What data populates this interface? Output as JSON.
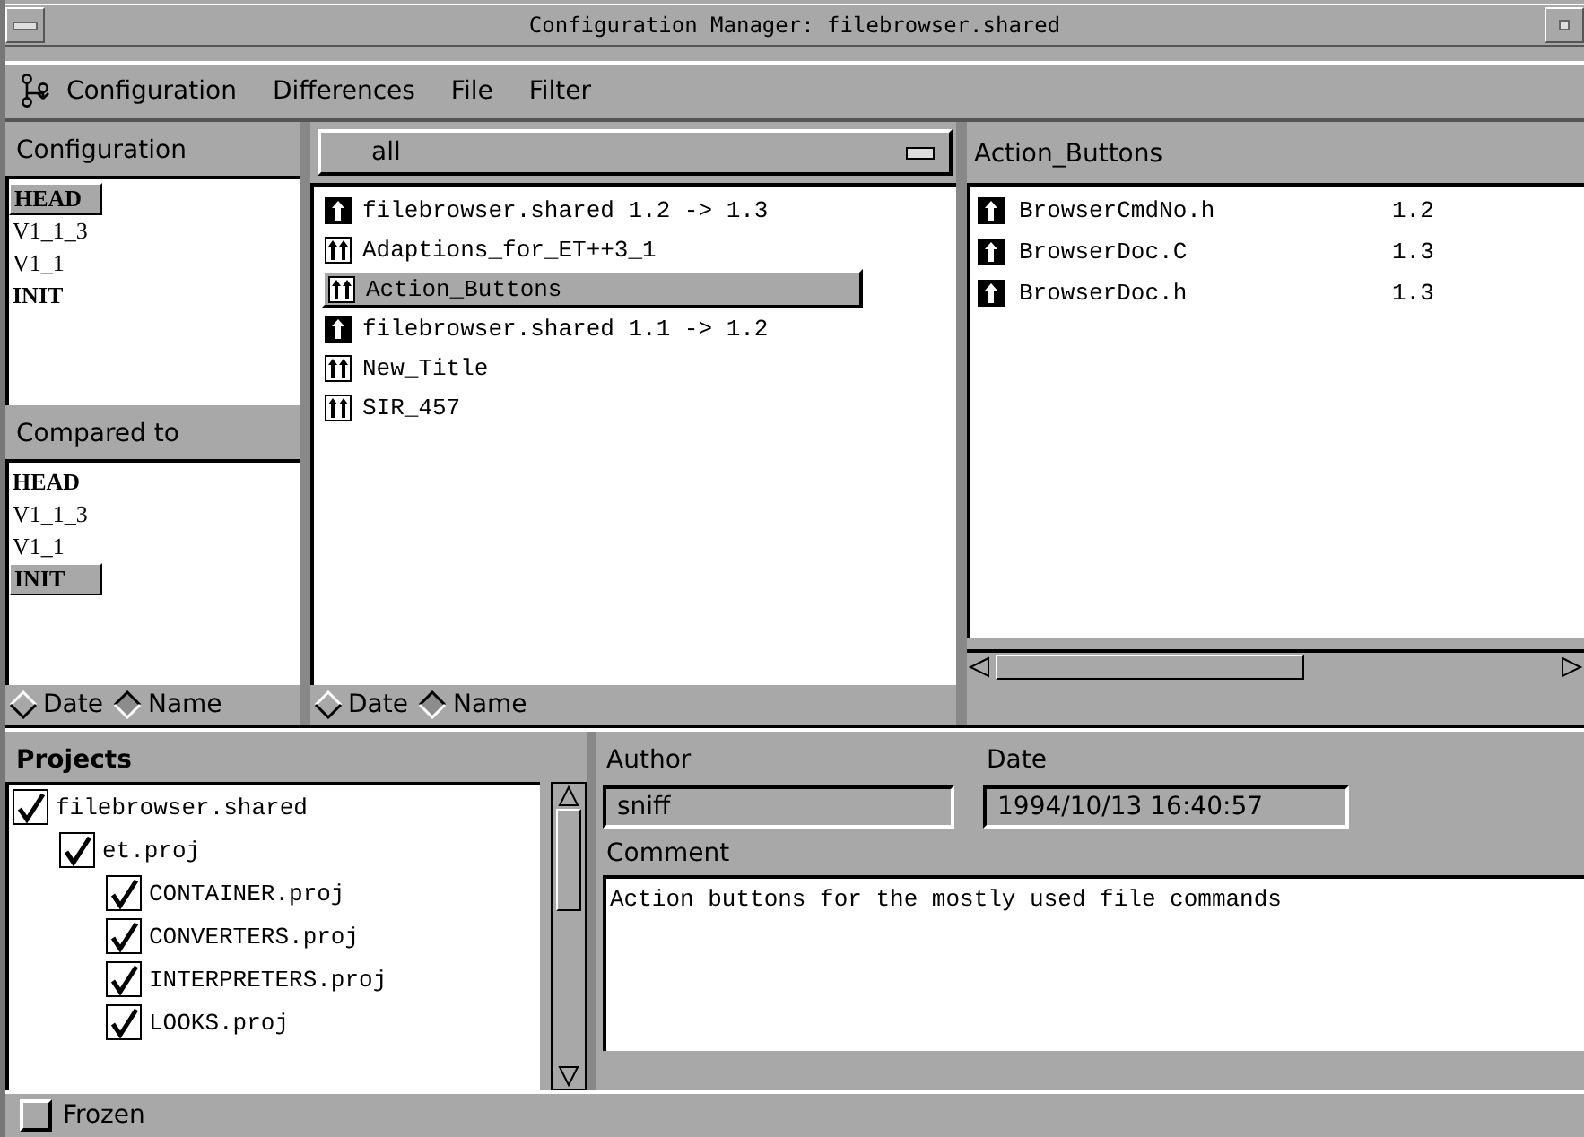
{
  "window": {
    "title": "Configuration Manager: filebrowser.shared"
  },
  "menu": [
    "Configuration",
    "Differences",
    "File",
    "Filter"
  ],
  "configuration": {
    "title": "Configuration",
    "items": [
      {
        "label": "HEAD",
        "bold": true,
        "selected": true
      },
      {
        "label": "V1_1_3",
        "bold": false,
        "selected": false
      },
      {
        "label": "V1_1",
        "bold": false,
        "selected": false
      },
      {
        "label": "INIT",
        "bold": true,
        "selected": false
      }
    ]
  },
  "compared_to": {
    "title": "Compared to",
    "items": [
      {
        "label": "HEAD",
        "bold": true,
        "selected": false
      },
      {
        "label": "V1_1_3",
        "bold": false,
        "selected": false
      },
      {
        "label": "V1_1",
        "bold": false,
        "selected": false
      },
      {
        "label": "INIT",
        "bold": true,
        "selected": true
      }
    ]
  },
  "left_sort": [
    {
      "label": "Date",
      "selected": false
    },
    {
      "label": "Name",
      "selected": true
    }
  ],
  "changes": {
    "filter": "all",
    "items": [
      {
        "kind": "single",
        "label": "filebrowser.shared 1.2 -> 1.3",
        "selected": false
      },
      {
        "kind": "double",
        "label": "Adaptions_for_ET++3_1",
        "selected": false
      },
      {
        "kind": "double",
        "label": "Action_Buttons",
        "selected": true
      },
      {
        "kind": "single",
        "label": "filebrowser.shared 1.1 -> 1.2",
        "selected": false
      },
      {
        "kind": "double",
        "label": "New_Title",
        "selected": false
      },
      {
        "kind": "double",
        "label": "SIR_457",
        "selected": false
      }
    ]
  },
  "middle_sort": [
    {
      "label": "Date",
      "selected": false
    },
    {
      "label": "Name",
      "selected": true
    }
  ],
  "files": {
    "title": "Action_Buttons",
    "items": [
      {
        "name": "BrowserCmdNo.h",
        "version": "1.2"
      },
      {
        "name": "BrowserDoc.C",
        "version": "1.3"
      },
      {
        "name": "BrowserDoc.h",
        "version": "1.3"
      }
    ]
  },
  "projects": {
    "title": "Projects",
    "tree": [
      {
        "label": "filebrowser.shared",
        "checked": true,
        "children": [
          {
            "label": "et.proj",
            "checked": true,
            "children": [
              {
                "label": "CONTAINER.proj",
                "checked": true
              },
              {
                "label": "CONVERTERS.proj",
                "checked": true
              },
              {
                "label": "INTERPRETERS.proj",
                "checked": true
              },
              {
                "label": "LOOKS.proj",
                "checked": true
              }
            ]
          }
        ]
      }
    ]
  },
  "details": {
    "author_label": "Author",
    "author": "sniff",
    "date_label": "Date",
    "date": "1994/10/13 16:40:57",
    "comment_label": "Comment",
    "comment": "Action buttons for the mostly used file commands"
  },
  "status_bar": {
    "frozen": {
      "label": "Frozen",
      "checked": false
    }
  }
}
